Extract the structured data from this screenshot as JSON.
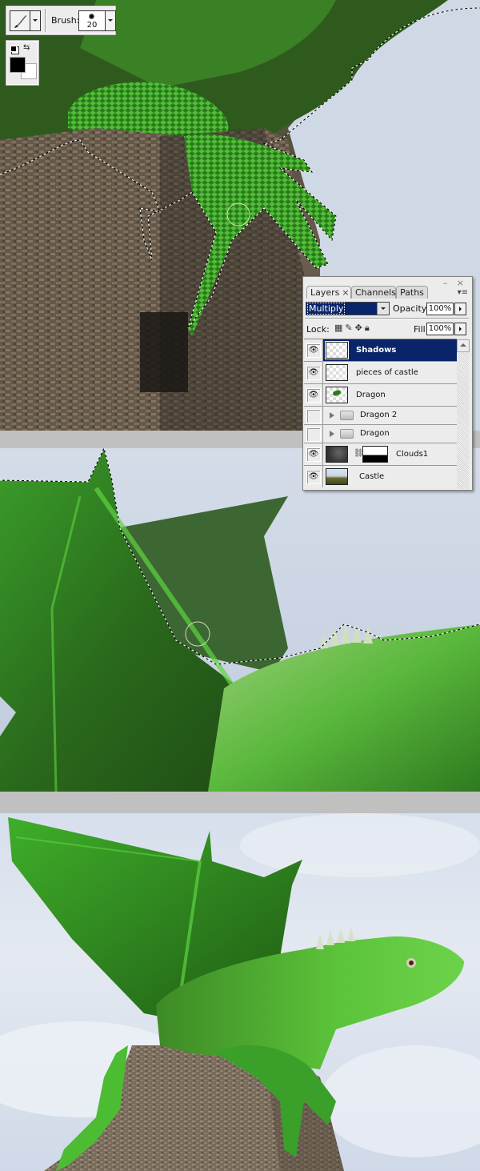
{
  "tool_options": {
    "tool_icon": "brush-icon",
    "brush_label": "Brush:",
    "brush_size": "20"
  },
  "color_picker": {
    "foreground": "#000000",
    "background": "#ffffff",
    "default_icon": "default-colors-icon",
    "swap_icon": "swap-colors-icon"
  },
  "layers_panel": {
    "tabs": [
      {
        "label": "Layers",
        "active": true,
        "close": "×"
      },
      {
        "label": "Channels",
        "active": false
      },
      {
        "label": "Paths",
        "active": false
      }
    ],
    "window_buttons": "– ×",
    "menu_icon": "▾≡",
    "blend_mode": "Multiply",
    "opacity_label": "Opacity:",
    "opacity_value": "100%",
    "lock_label": "Lock:",
    "fill_label": "Fill:",
    "fill_value": "100%",
    "layers": [
      {
        "name": "Shadows",
        "visible": true,
        "selected": true,
        "type": "layer"
      },
      {
        "name": "pieces of castle",
        "visible": true,
        "selected": false,
        "type": "layer"
      },
      {
        "name": "Dragon",
        "visible": true,
        "selected": false,
        "type": "layer"
      },
      {
        "name": "Dragon 2",
        "visible": false,
        "selected": false,
        "type": "group"
      },
      {
        "name": "Dragon",
        "visible": false,
        "selected": false,
        "type": "group"
      },
      {
        "name": "Clouds1",
        "visible": true,
        "selected": false,
        "type": "masked-layer"
      },
      {
        "name": "Castle",
        "visible": true,
        "selected": false,
        "type": "layer"
      }
    ]
  },
  "colors": {
    "selection_bg": "#0a246a",
    "panel_bg": "#ececec",
    "separator": "#c0c0c0",
    "dragon_green": "#3fae2a",
    "sky": "#d4dce8",
    "stone": "#6b5e4f"
  }
}
